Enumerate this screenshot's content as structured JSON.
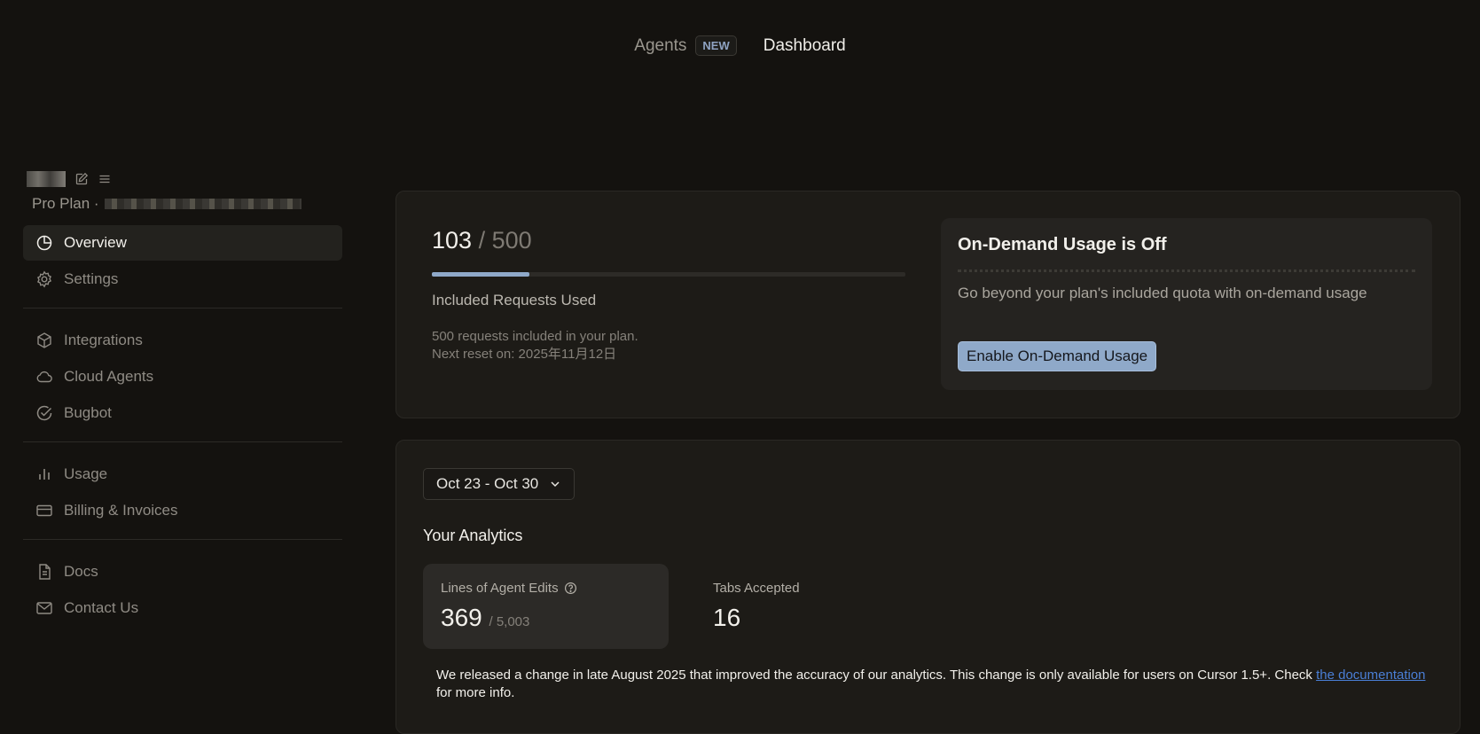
{
  "topnav": {
    "agents": "Agents",
    "badge": "NEW",
    "dashboard": "Dashboard"
  },
  "sidebar": {
    "plan_text": "Pro Plan ·",
    "nav": {
      "overview": "Overview",
      "settings": "Settings",
      "integrations": "Integrations",
      "cloud_agents": "Cloud Agents",
      "bugbot": "Bugbot",
      "usage": "Usage",
      "billing": "Billing & Invoices",
      "docs": "Docs",
      "contact": "Contact Us"
    }
  },
  "usage": {
    "used": "103",
    "total": " / 500",
    "progress_fraction": 0.206,
    "label": "Included Requests Used",
    "note_line1": "500 requests included in your plan.",
    "note_line2": "Next reset on: 2025年11月12日"
  },
  "on_demand": {
    "title": "On-Demand Usage is Off",
    "description": "Go beyond your plan's included quota with on-demand usage",
    "button": "Enable On-Demand Usage"
  },
  "analytics": {
    "date_range": "Oct 23 - Oct 30",
    "title": "Your Analytics",
    "agent_edits": {
      "label": "Lines of Agent Edits",
      "value": "369",
      "sub": "/ 5,003"
    },
    "tabs_accepted": {
      "label": "Tabs Accepted",
      "value": "16"
    },
    "info": {
      "text": "We released a change in late August 2025 that improved the accuracy of our analytics. This change is only available for users on Cursor 1.5+. Check ",
      "link": "the documentation",
      "after": " for more info."
    }
  },
  "colors": {
    "background": "#14120f",
    "card": "#1d1b17",
    "accent": "#8fa9c9",
    "link": "#4a7fd6"
  }
}
